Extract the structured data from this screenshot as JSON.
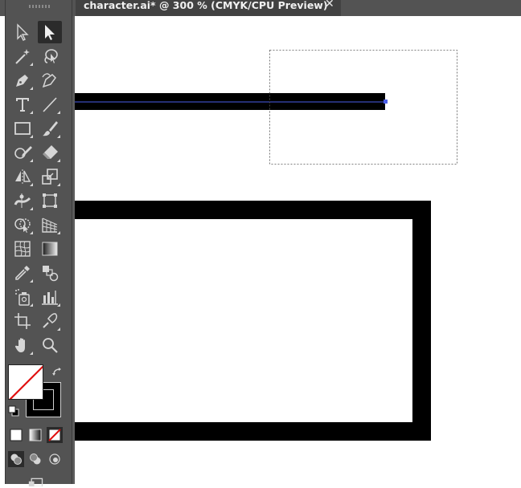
{
  "window": {
    "tab_title": "character.ai* @ 300 % (CMYK/CPU Preview)",
    "close_glyph": "✕"
  },
  "toolbar": {
    "tools": [
      {
        "name": "selection-tool",
        "icon": "arrow-outline-icon"
      },
      {
        "name": "direct-selection-tool",
        "icon": "arrow-solid-icon",
        "active": true
      },
      {
        "name": "magic-wand-tool",
        "icon": "magic-wand-icon"
      },
      {
        "name": "lasso-tool",
        "icon": "lasso-icon"
      },
      {
        "name": "pen-tool",
        "icon": "pen-icon"
      },
      {
        "name": "curvature-tool",
        "icon": "curvature-pen-icon"
      },
      {
        "name": "type-tool",
        "icon": "type-icon",
        "glyph": "T"
      },
      {
        "name": "line-segment-tool",
        "icon": "line-icon"
      },
      {
        "name": "rectangle-tool",
        "icon": "rectangle-icon"
      },
      {
        "name": "paintbrush-tool",
        "icon": "paintbrush-icon"
      },
      {
        "name": "shaper-tool",
        "icon": "shaper-icon"
      },
      {
        "name": "eraser-tool",
        "icon": "eraser-icon"
      },
      {
        "name": "reflect-tool",
        "icon": "reflect-icon"
      },
      {
        "name": "scale-tool",
        "icon": "scale-icon"
      },
      {
        "name": "width-tool",
        "icon": "width-icon"
      },
      {
        "name": "free-transform-tool",
        "icon": "free-transform-icon"
      },
      {
        "name": "shape-builder-tool",
        "icon": "shape-builder-icon"
      },
      {
        "name": "perspective-grid-tool",
        "icon": "perspective-grid-icon"
      },
      {
        "name": "mesh-tool",
        "icon": "mesh-icon"
      },
      {
        "name": "gradient-tool",
        "icon": "gradient-icon"
      },
      {
        "name": "eyedropper-tool",
        "icon": "eyedropper-icon"
      },
      {
        "name": "blend-tool",
        "icon": "blend-icon"
      },
      {
        "name": "symbol-sprayer-tool",
        "icon": "symbol-sprayer-icon"
      },
      {
        "name": "column-graph-tool",
        "icon": "column-graph-icon"
      },
      {
        "name": "artboard-tool",
        "icon": "artboard-icon"
      },
      {
        "name": "slice-tool",
        "icon": "slice-knife-icon"
      },
      {
        "name": "hand-tool",
        "icon": "hand-icon"
      },
      {
        "name": "zoom-tool",
        "icon": "magnifier-icon"
      }
    ],
    "fill": {
      "color": "none"
    },
    "stroke": {
      "color": "#000000"
    },
    "colors": {
      "panel": "#535353",
      "active": "#2b2b2b",
      "icon": "#d6d6d6"
    }
  },
  "canvas": {
    "background": "#ffffff",
    "selection_color": "#4a5ee8"
  }
}
